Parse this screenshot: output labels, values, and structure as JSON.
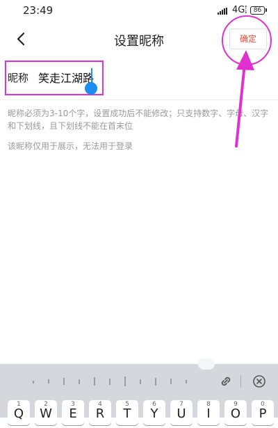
{
  "status": {
    "time": "23:49",
    "network": "4G",
    "battery": "86"
  },
  "nav": {
    "title": "设置昵称",
    "confirm_label": "确定"
  },
  "form": {
    "label": "昵称",
    "value": "笑走江湖路"
  },
  "hints": {
    "rules": "昵称必须为3-10个字，设置成功后不能修改；只支持数字、字母、汉字和下划线，且下划线不能在首末位",
    "display": "该昵称仅用于展示，无法用于登录"
  },
  "keyboard": {
    "keys": [
      {
        "num": "1",
        "letter": "Q"
      },
      {
        "num": "2",
        "letter": "W"
      },
      {
        "num": "3",
        "letter": "E"
      },
      {
        "num": "4",
        "letter": "R"
      },
      {
        "num": "5",
        "letter": "T"
      },
      {
        "num": "6",
        "letter": "Y"
      },
      {
        "num": "7",
        "letter": "U"
      },
      {
        "num": "8",
        "letter": "I"
      },
      {
        "num": "9",
        "letter": "O"
      },
      {
        "num": "0",
        "letter": "P"
      }
    ]
  },
  "colors": {
    "confirm_text": "#e64a3b",
    "annotation": "#e030d0",
    "cursor": "#1d8ef0"
  }
}
